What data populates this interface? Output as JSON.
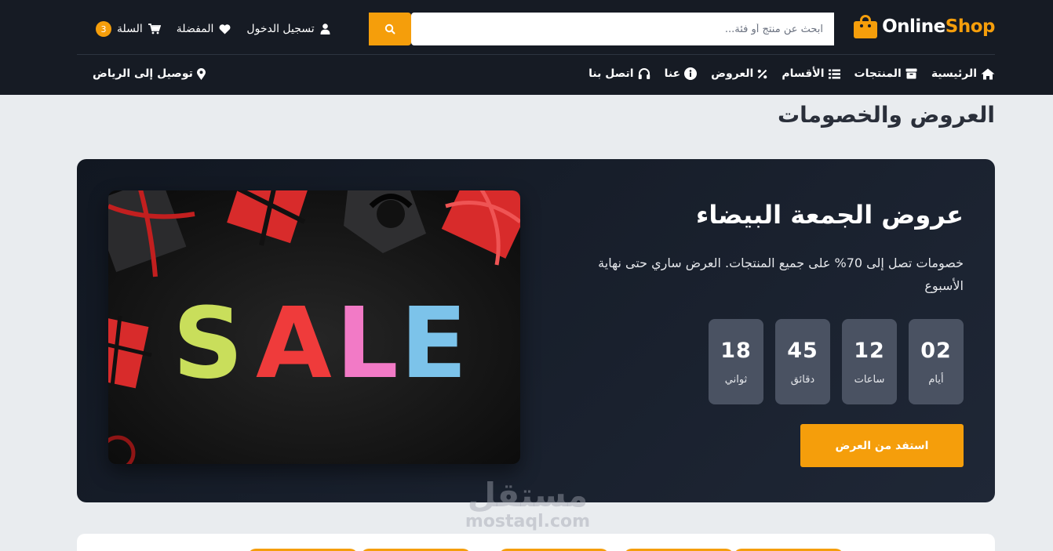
{
  "header": {
    "logo": {
      "part1": "Online",
      "part2": "Shop"
    },
    "search": {
      "placeholder": "ابحث عن منتج أو فئة...",
      "value": ""
    },
    "links": {
      "login": "تسجيل الدخول",
      "favorites": "المفضلة",
      "cart": "السلة",
      "cart_count": "3"
    },
    "nav": {
      "home": "الرئيسية",
      "products": "المنتجات",
      "categories": "الأقسام",
      "offers": "العروض",
      "about": "عنا",
      "contact": "اتصل بنا"
    },
    "delivery": "توصيل إلى الرياض"
  },
  "page": {
    "title": "العروض والخصومات"
  },
  "offer": {
    "title": "عروض الجمعة البيضاء",
    "description": "خصومات تصل إلى 70% على جميع المنتجات. العرض ساري حتى نهاية الأسبوع",
    "countdown": {
      "days": {
        "value": "02",
        "label": "أيام"
      },
      "hours": {
        "value": "12",
        "label": "ساعات"
      },
      "minutes": {
        "value": "45",
        "label": "دقائق"
      },
      "seconds": {
        "value": "18",
        "label": "ثواني"
      }
    },
    "cta": "استفد من العرض",
    "image": {
      "text": "SALE",
      "letter_colors": [
        "#c9de5b",
        "#ef3b3b",
        "#f27ac6",
        "#7cc3ea"
      ]
    }
  },
  "watermark": {
    "ar": "مستقل",
    "en": "mostaql.com"
  },
  "colors": {
    "accent": "#f59e0b",
    "header_bg": "#161b24",
    "card_bg": "#1a2130"
  },
  "icons": [
    "shopping-bag-icon",
    "search-icon",
    "user-icon",
    "heart-icon",
    "cart-icon",
    "home-icon",
    "box-icon",
    "list-icon",
    "percent-icon",
    "info-icon",
    "headset-icon",
    "map-pin-icon"
  ]
}
